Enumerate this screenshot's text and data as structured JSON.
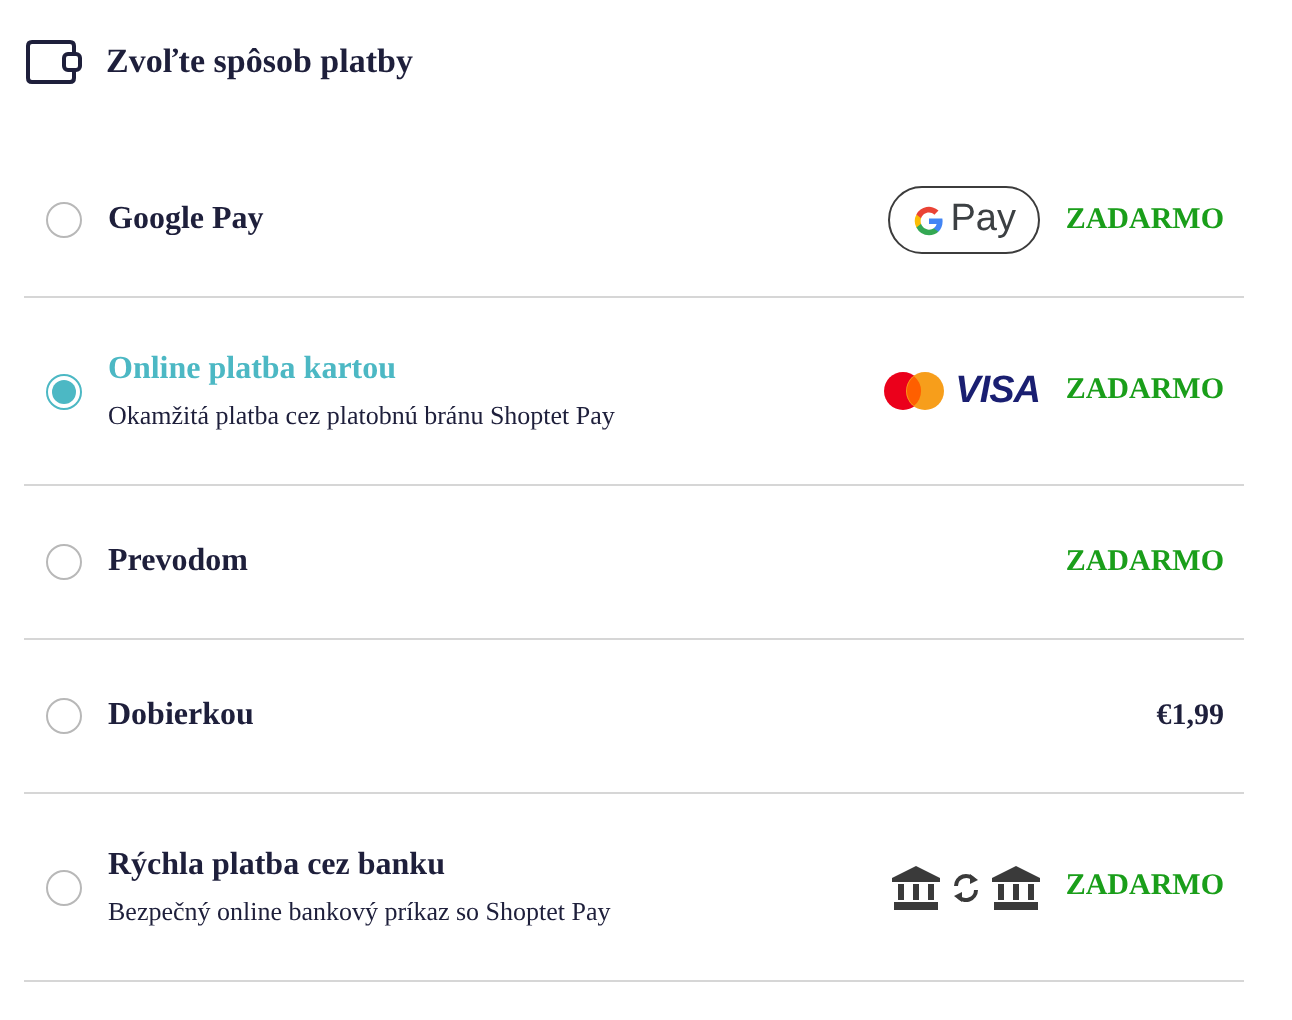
{
  "title": "Zvoľte spôsob platby",
  "methods": [
    {
      "name": "Google Pay",
      "selected": false,
      "logos": [
        {
          "kind": "gpay",
          "text": "Pay"
        }
      ],
      "price": "ZADARMO",
      "free": true
    },
    {
      "name": "Online platba kartou",
      "description": "Okamžitá platba cez platobnú bránu Shoptet Pay",
      "selected": true,
      "logos": [
        {
          "kind": "mastercard"
        },
        {
          "kind": "visa",
          "text": "VISA"
        }
      ],
      "price": "ZADARMO",
      "free": true
    },
    {
      "name": "Prevodom",
      "selected": false,
      "price": "ZADARMO",
      "free": true
    },
    {
      "name": "Dobierkou",
      "selected": false,
      "price": "€1,99",
      "free": false
    },
    {
      "name": "Rýchla platba cez banku",
      "description": "Bezpečný online bankový príkaz so Shoptet Pay",
      "selected": false,
      "logos": [
        {
          "kind": "bank"
        },
        {
          "kind": "swap"
        },
        {
          "kind": "bank"
        }
      ],
      "price": "ZADARMO",
      "free": true
    }
  ]
}
